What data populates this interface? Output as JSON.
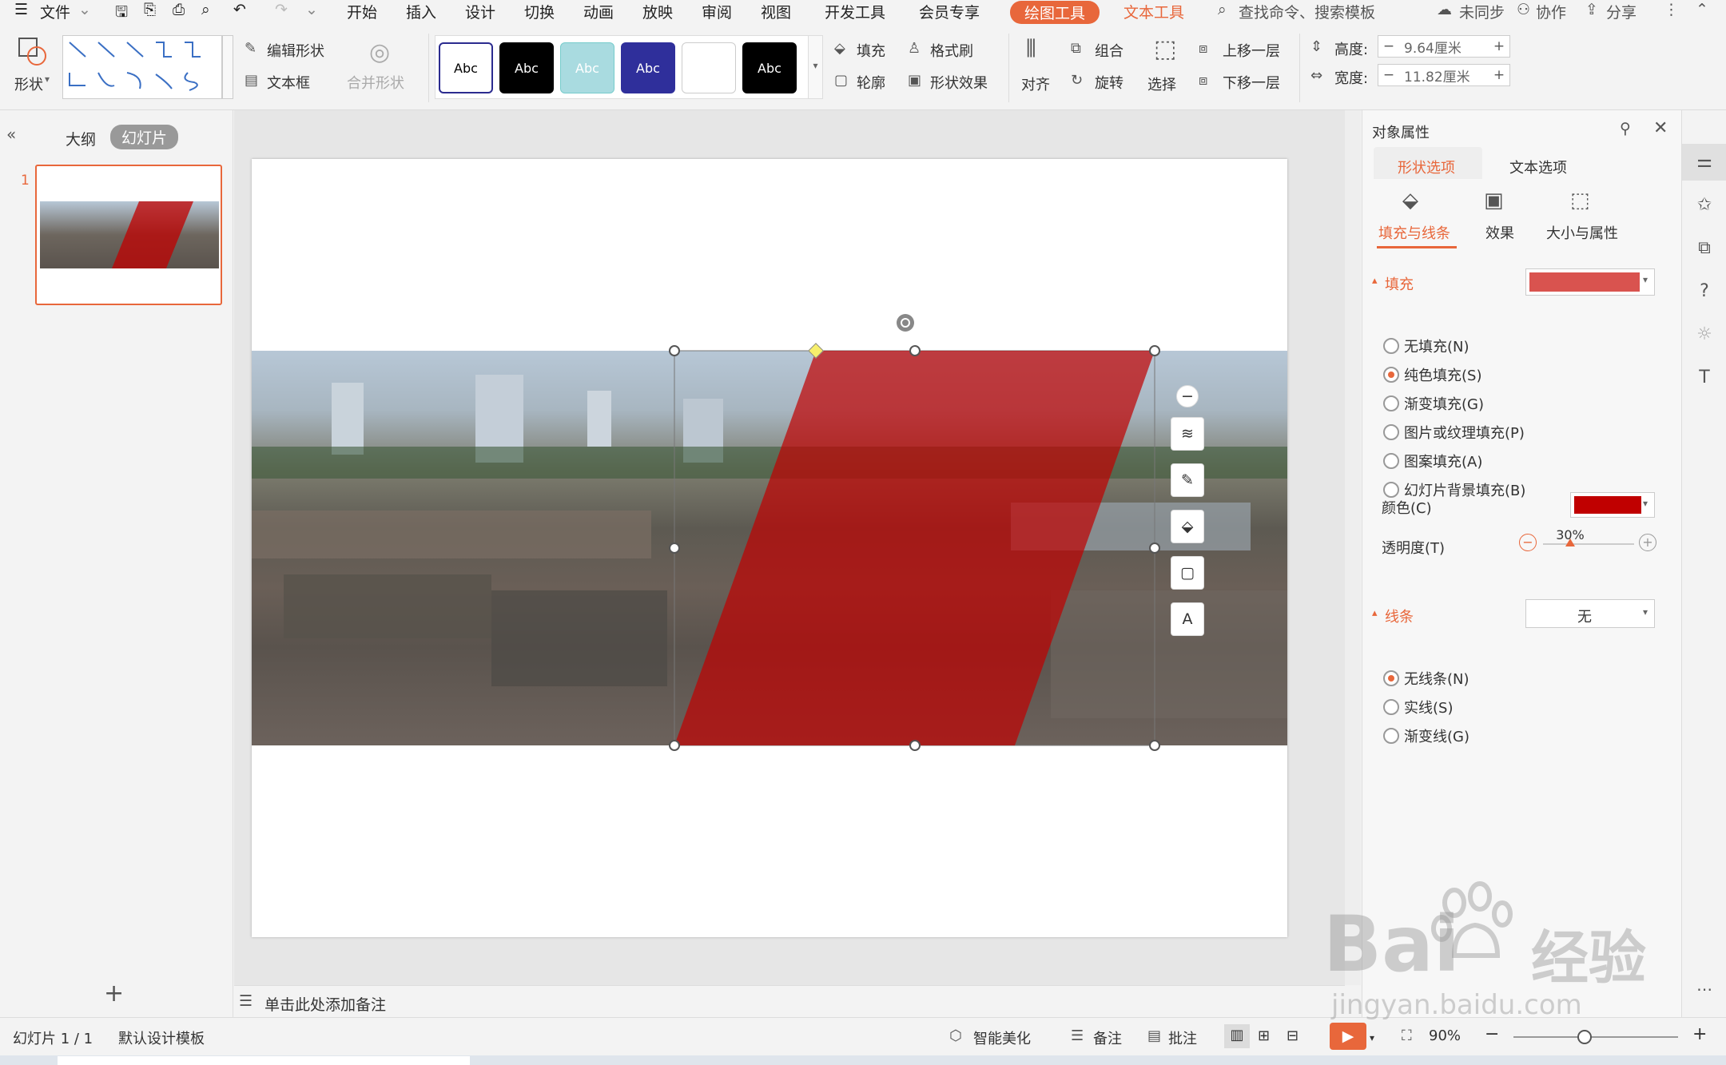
{
  "menubar": {
    "file": "文件",
    "tabs": [
      "开始",
      "插入",
      "设计",
      "切换",
      "动画",
      "放映",
      "审阅",
      "视图",
      "开发工具",
      "会员专享"
    ],
    "active_tab": "绘图工具",
    "text_tool": "文本工具",
    "search": "查找命令、搜索模板",
    "sync": "未同步",
    "collab": "协作",
    "share": "分享"
  },
  "ribbon": {
    "shape": "形状",
    "edit_shape": "编辑形状",
    "textbox": "文本框",
    "merge_shape": "合并形状",
    "style_label": "Abc",
    "fill": "填充",
    "format_brush": "格式刷",
    "outline": "轮廓",
    "shape_effect": "形状效果",
    "align": "对齐",
    "group": "组合",
    "rotate": "旋转",
    "select": "选择",
    "bring_forward": "上移一层",
    "send_backward": "下移一层",
    "height_label": "高度:",
    "height_value": "9.64厘米",
    "width_label": "宽度:",
    "width_value": "11.82厘米"
  },
  "leftpanel": {
    "outline_tab": "大纲",
    "slides_tab": "幻灯片",
    "slide_number": "1",
    "add": "+"
  },
  "notes": {
    "placeholder": "单击此处添加备注"
  },
  "rightpanel": {
    "title": "对象属性",
    "tab_shape": "形状选项",
    "tab_text": "文本选项",
    "sub_fill_line": "填充与线条",
    "sub_effect": "效果",
    "sub_size": "大小与属性",
    "fill_header": "填充",
    "fill_options": [
      "无填充(N)",
      "纯色填充(S)",
      "渐变填充(G)",
      "图片或纹理填充(P)",
      "图案填充(A)",
      "幻灯片背景填充(B)"
    ],
    "fill_selected": 1,
    "color_label": "颜色(C)",
    "transparency_label": "透明度(T)",
    "transparency_value": "30%",
    "transparency_level": 0.3,
    "line_header": "线条",
    "line_value": "无",
    "line_options": [
      "无线条(N)",
      "实线(S)",
      "渐变线(G)"
    ],
    "line_selected": 0,
    "fill_swatch_color": "#d9534f",
    "color_swatch_color": "#c00000"
  },
  "statusbar": {
    "slide_info": "幻灯片 1 / 1",
    "template": "默认设计模板",
    "beautify": "智能美化",
    "notes": "备注",
    "comment": "批注",
    "zoom": "90%",
    "zoom_minus": "−",
    "zoom_plus": "+"
  },
  "watermark": {
    "brand": "Bai",
    "brand2": "经验",
    "url": "jingyan.baidu.com"
  },
  "colors": {
    "accent": "#e8673b",
    "shape_red": "#c00000"
  }
}
